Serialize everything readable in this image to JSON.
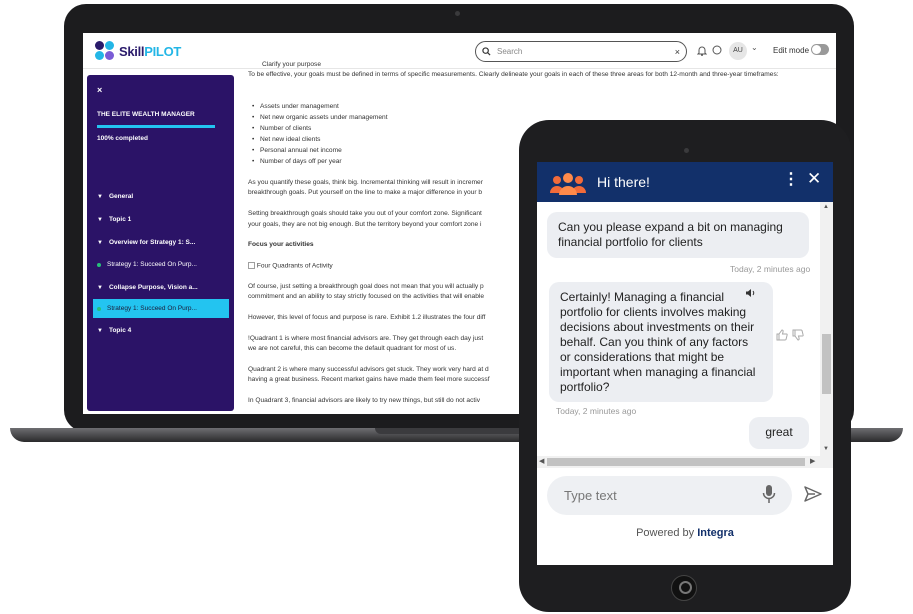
{
  "app": {
    "logo_skill": "Skill",
    "logo_pilot": "PILOT",
    "search_placeholder": "Search",
    "search_clear": "×",
    "avatar": "AU",
    "avatar_chevron": "⌄",
    "edit_mode_label": "Edit mode"
  },
  "sidebar": {
    "close": "×",
    "course_title": "THE ELITE WEALTH MANAGER",
    "progress_percent": 100,
    "completed": "100% completed",
    "items": [
      {
        "label": "General"
      },
      {
        "label": "Topic 1"
      },
      {
        "label": "Overview for Strategy 1: S..."
      },
      {
        "label": "Strategy 1: Succeed On Purp..."
      },
      {
        "label": "Collapse Purpose, Vision a..."
      },
      {
        "label": "Strategy 1: Succeed On Purp..."
      },
      {
        "label": "Topic 4"
      }
    ]
  },
  "content": {
    "line0": "Clarify your purpose",
    "p1": "To be effective, your goals must be defined in terms of specific measurements. Clearly delineate your goals in each of these three areas for both 12-month and three-year timeframes:",
    "bullets": [
      "Assets under management",
      "Net new organic assets under management",
      "Number of clients",
      "Net new ideal clients",
      "Personal annual net income",
      "Number of days off per year"
    ],
    "p2": "As you quantify these goals, think big. Incremental thinking will result in incremer",
    "p2b": "breakthrough goals. Put yourself on the line to make a major difference in your b",
    "p3": "Setting breakthrough goals should take you out of your comfort zone. Significant",
    "p3b": "your goals, they are not big enough. But the territory beyond your comfort zone i",
    "h1": "Focus your activities",
    "img_alt": "Four Quadrants of Activity",
    "p4": "Of course, just setting a breakthrough goal does not mean that you will actually p",
    "p4b": "commitment and an ability to stay strictly focused on the activities that will enable",
    "p5": "However, this level of focus and purpose is rare. Exhibit 1.2 illustrates the four diff",
    "p6": "!Quadrant 1 is where most financial advisors are. They get through each day just",
    "p6b": "we are not careful, this can become the default quadrant for most of us.",
    "p7": "Quadrant 2 is where many successful advisors get stuck. They work very hard at d",
    "p7b": "having a great business. Recent market gains have made them feel more successf",
    "p8": "In Quadrant 3, financial advisors are likely to try new things, but still do not activ"
  },
  "chat": {
    "title": "Hi there!",
    "menu": "⋮",
    "close": "✕",
    "user_message": "Can you please expand a bit on managing financial portfolio for clients",
    "user_time": "Today, 2 minutes ago",
    "bot_message": "Certainly! Managing a financial portfolio for clients involves making decisions about investments on their behalf. Can you think of any factors or considerations that might be important when managing a financial portfolio?",
    "bot_time": "Today, 2 minutes ago",
    "reply": "great",
    "input_placeholder": "Type text",
    "powered_prefix": "Powered by",
    "powered_brand": "Integra"
  },
  "colors": {
    "sidebar_bg": "#2b1367",
    "accent": "#23c4f0",
    "chat_header": "#12306a"
  }
}
